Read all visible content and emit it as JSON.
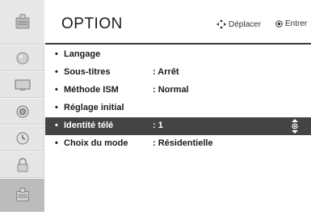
{
  "header": {
    "title": "OPTION",
    "hint_move": "Déplacer",
    "hint_enter": "Entrer"
  },
  "rail": {
    "icons": [
      "option-icon",
      "picture-icon",
      "screen-icon",
      "audio-icon",
      "time-icon",
      "lock-icon",
      "option-icon"
    ],
    "active_index": 6
  },
  "menu": {
    "items": [
      {
        "label": "Langage",
        "value": ""
      },
      {
        "label": "Sous-titres",
        "value": ": Arrêt"
      },
      {
        "label": "Méthode ISM",
        "value": ": Normal"
      },
      {
        "label": "Réglage initial",
        "value": ""
      },
      {
        "label": "Identité télé",
        "value": ": 1"
      },
      {
        "label": "Choix du mode",
        "value": ": Résidentielle"
      }
    ],
    "selected_index": 4,
    "bullet": "•"
  }
}
